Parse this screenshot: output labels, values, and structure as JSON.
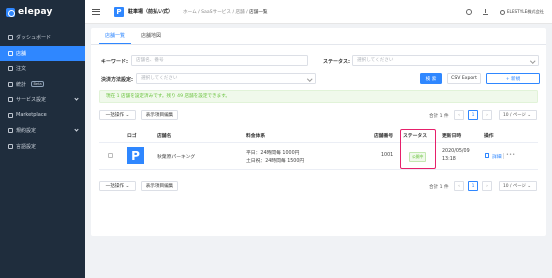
{
  "brand": {
    "name": "elepay",
    "accent": "#2f87ff"
  },
  "sidebar": {
    "items": [
      {
        "label": "ダッシュボード",
        "icon": "dashboard-icon",
        "active": false
      },
      {
        "label": "店舗",
        "icon": "store-icon",
        "active": true
      },
      {
        "label": "注文",
        "icon": "order-icon",
        "active": false
      },
      {
        "label": "統計",
        "icon": "stats-icon",
        "active": false,
        "badge": "Beta"
      },
      {
        "label": "サービス設定",
        "icon": "service-icon",
        "active": false,
        "expandable": true
      },
      {
        "label": "Marketplace",
        "icon": "marketplace-icon",
        "active": false
      },
      {
        "label": "規約設定",
        "icon": "terms-icon",
        "active": false,
        "expandable": true
      },
      {
        "label": "言語設定",
        "icon": "language-icon",
        "active": false
      }
    ]
  },
  "header": {
    "store_badge": "P",
    "store_name": "駐車場（前払い式）",
    "breadcrumb": [
      "ホーム",
      "SaaSサービス",
      "店舗",
      "店舗一覧"
    ],
    "user": "ELESTYLE株式会社"
  },
  "tabs": [
    {
      "label": "店舗一覧",
      "active": true
    },
    {
      "label": "店舗地図",
      "active": false
    }
  ],
  "filters": {
    "keyword_label": "キーワード:",
    "keyword_placeholder": "店舗名、番号",
    "status_label": "ステータス:",
    "status_placeholder": "選択してください",
    "payment_label": "決済方法設定:",
    "payment_placeholder": "選択してください"
  },
  "actions": {
    "search": "検 索",
    "csv_export": "CSV Export",
    "new": "+ 新規"
  },
  "notice": "現在 1 店舗を設定済みです。残り 49 店舗を設定できます。",
  "toolbar": {
    "bulk_label": "一括操作",
    "columns_label": "表示項目編集",
    "total": "合計 1 件",
    "current_page": "1",
    "page_size": "10 / ページ"
  },
  "table": {
    "headers": [
      "ロゴ",
      "店舗名",
      "料金体系",
      "店舗番号",
      "ステータス",
      "更新日時",
      "操作"
    ],
    "rows": [
      {
        "logo": "P",
        "name": "秋葉原パーキング",
        "pricing_1": "平日：24時間毎 1000円",
        "pricing_2": "土日祝：24時間毎 1500円",
        "number": "1001",
        "status": "公開中",
        "updated_date": "2020/05/09",
        "updated_time": "13:18",
        "op_label": "詳細",
        "more": "•••"
      }
    ]
  },
  "colors": {
    "highlight": "#e6206b",
    "success": "#67c23a"
  }
}
